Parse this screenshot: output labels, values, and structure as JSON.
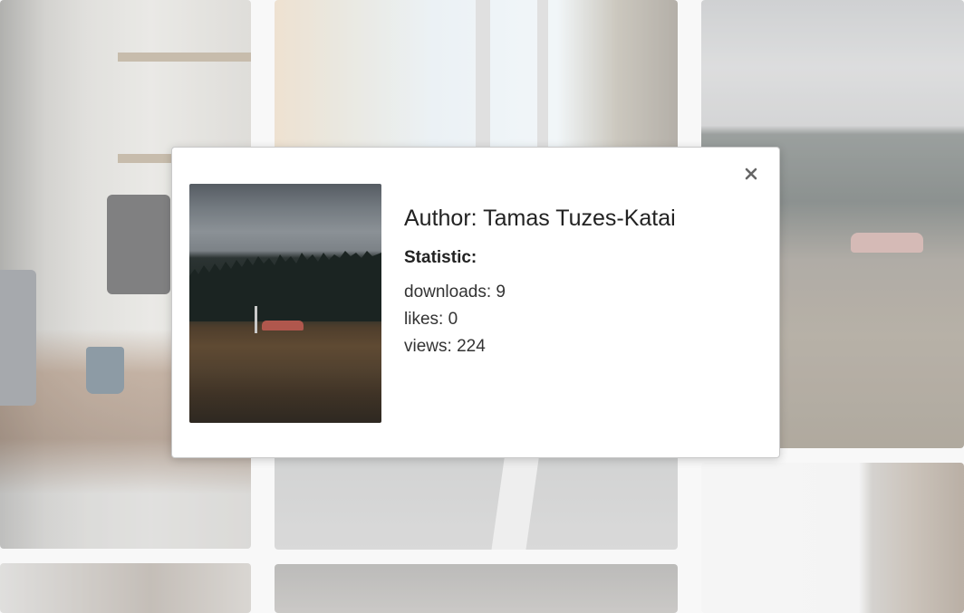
{
  "modal": {
    "author_label": "Author:",
    "author_name": "Tamas Tuzes-Katai",
    "statistic_label": "Statistic:",
    "stats": [
      {
        "label": "downloads:",
        "value": "9"
      },
      {
        "label": "likes:",
        "value": "0"
      },
      {
        "label": "views:",
        "value": "224"
      }
    ],
    "close_icon": "close-icon"
  },
  "colors": {
    "modal_bg": "#ffffff",
    "text": "#222222",
    "close": "#666666"
  }
}
